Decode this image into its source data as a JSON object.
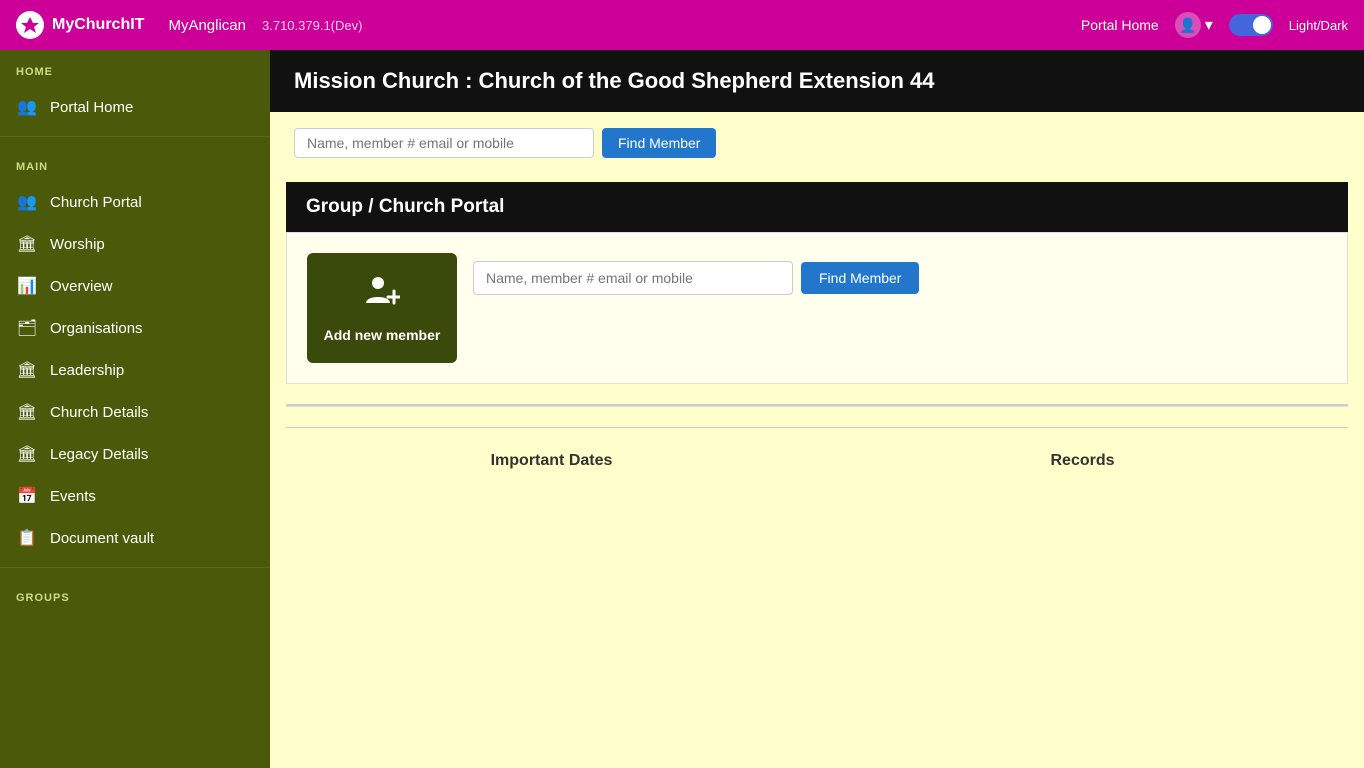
{
  "navbar": {
    "logo_text": "✦",
    "app_name": "MyChurchIT",
    "sub_name": "MyAnglican",
    "version": "3.710.379.1(Dev)",
    "portal_home_label": "Portal Home",
    "light_dark_label": "Light/Dark",
    "user_icon": "👤",
    "chevron_down": "▾"
  },
  "sidebar": {
    "home_label": "HOME",
    "home_items": [
      {
        "label": "Portal Home",
        "icon": "👥"
      }
    ],
    "main_label": "MAIN",
    "main_items": [
      {
        "label": "Church Portal",
        "icon": "👥"
      },
      {
        "label": "Worship",
        "icon": "🏛"
      },
      {
        "label": "Overview",
        "icon": "📊"
      },
      {
        "label": "Organisations",
        "icon": "🗂"
      },
      {
        "label": "Leadership",
        "icon": "🏛"
      },
      {
        "label": "Church Details",
        "icon": "🏛"
      },
      {
        "label": "Legacy Details",
        "icon": "🏛"
      },
      {
        "label": "Events",
        "icon": "📅"
      },
      {
        "label": "Document vault",
        "icon": "📋"
      }
    ],
    "groups_label": "GROUPS"
  },
  "page": {
    "title": "Mission Church : Church of the Good Shepherd  Extension 44",
    "search_placeholder": "Name, member # email or mobile",
    "find_member_label": "Find Member"
  },
  "group_portal": {
    "section_title": "Group / Church Portal",
    "add_member_label": "Add new member",
    "search_placeholder": "Name, member # email or mobile",
    "find_member_label": "Find Member"
  },
  "bottom": {
    "important_dates_label": "Important Dates",
    "records_label": "Records"
  }
}
